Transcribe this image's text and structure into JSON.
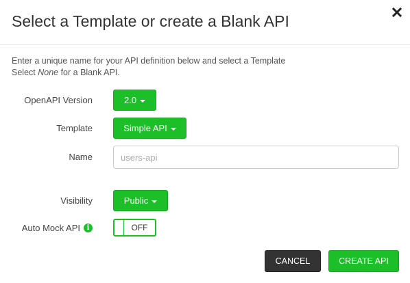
{
  "dialog": {
    "title": "Select a Template or create a Blank API",
    "close_icon": "close-icon"
  },
  "intro": {
    "line1": "Enter a unique name for your API definition below and select a Template",
    "line2_prefix": "Select ",
    "line2_em": "None",
    "line2_suffix": " for a Blank API."
  },
  "form": {
    "openapi_version": {
      "label": "OpenAPI Version",
      "value": "2.0"
    },
    "template": {
      "label": "Template",
      "value": "Simple API"
    },
    "name": {
      "label": "Name",
      "placeholder": "users-api",
      "value": ""
    },
    "visibility": {
      "label": "Visibility",
      "value": "Public"
    },
    "auto_mock": {
      "label": "Auto Mock API",
      "info_icon": "info-icon",
      "state": "OFF"
    }
  },
  "actions": {
    "cancel": "CANCEL",
    "create": "CREATE API"
  },
  "colors": {
    "accent": "#1cbf27",
    "dark_button": "#333333"
  }
}
